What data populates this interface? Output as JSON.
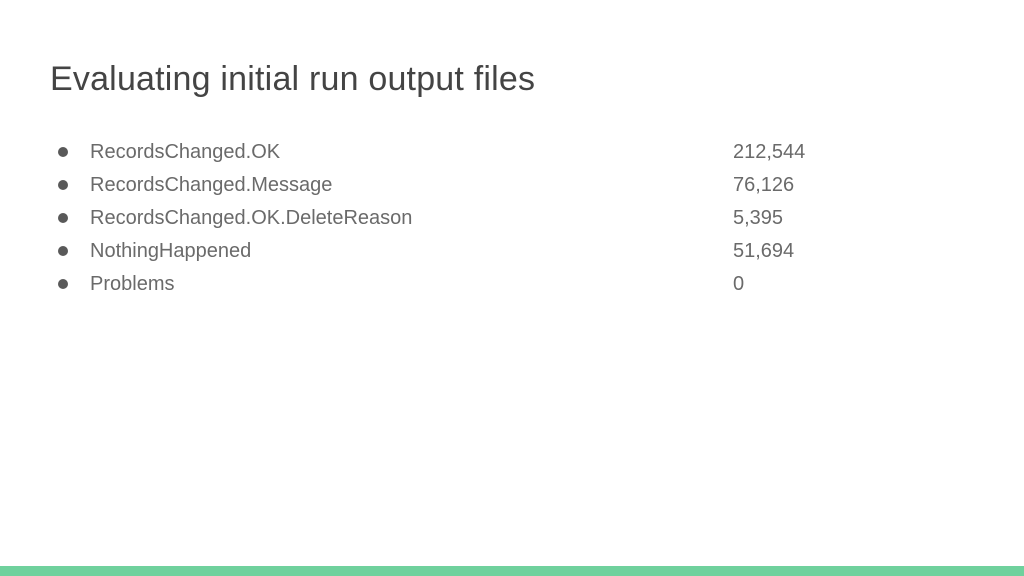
{
  "title": "Evaluating initial run output files",
  "items": [
    {
      "label": "RecordsChanged.OK",
      "value": "212,544"
    },
    {
      "label": "RecordsChanged.Message",
      "value": "76,126"
    },
    {
      "label": "RecordsChanged.OK.DeleteReason",
      "value": "5,395"
    },
    {
      "label": "NothingHappened",
      "value": "51,694"
    },
    {
      "label": "Problems",
      "value": "0"
    }
  ],
  "accent_color": "#6fd19d"
}
